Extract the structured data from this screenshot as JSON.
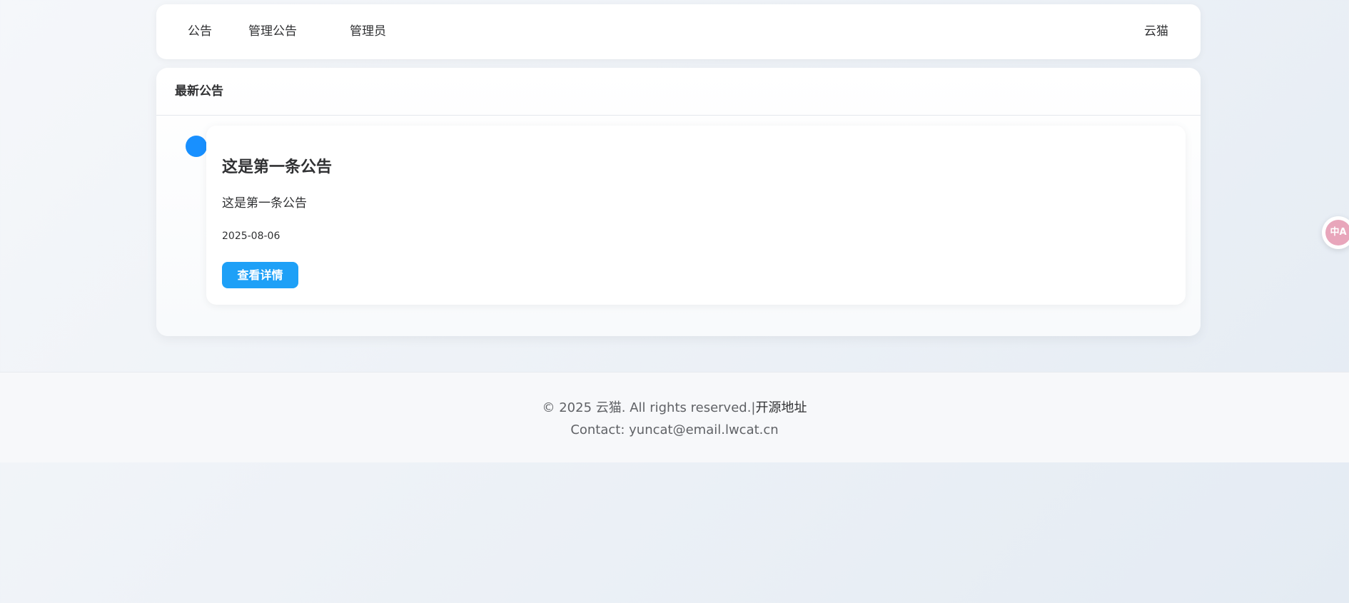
{
  "nav": {
    "items": [
      {
        "label": "公告"
      },
      {
        "label": "管理公告"
      },
      {
        "label": "管理员"
      }
    ],
    "user": "云猫"
  },
  "panel": {
    "header": "最新公告",
    "announcements": [
      {
        "title": "这是第一条公告",
        "content": "这是第一条公告",
        "date": "2025-08-06",
        "button_label": "查看详情"
      }
    ]
  },
  "footer": {
    "copyright": "© 2025 云猫. All rights reserved.|",
    "source_link": "开源地址",
    "contact": "Contact: yuncat@email.lwcat.cn"
  },
  "translate_widget": {
    "icon": "translate-icon",
    "glyph": "中A"
  },
  "colors": {
    "accent": "#1890ff",
    "button": "#1ea0f7",
    "translate": "#e8a6bb"
  }
}
